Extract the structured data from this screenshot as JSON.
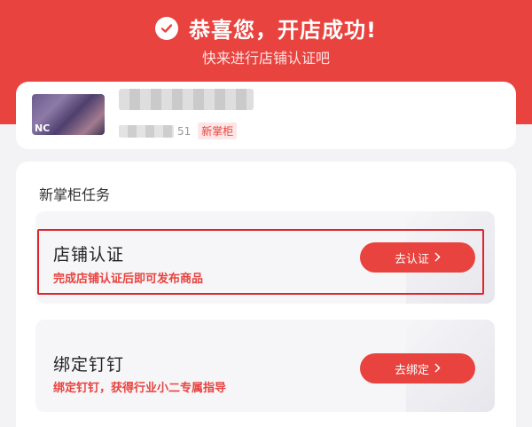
{
  "header": {
    "title": "恭喜您，开店成功!",
    "subtitle": "快来进行店铺认证吧"
  },
  "profile": {
    "avatar_text": "NC",
    "id_tail": "51",
    "role_badge": "新掌柜"
  },
  "tasks": {
    "title": "新掌柜任务",
    "items": [
      {
        "name": "店铺认证",
        "desc": "完成店铺认证后即可发布商品",
        "button": "去认证",
        "highlighted": true
      },
      {
        "name": "绑定钉钉",
        "desc": "绑定钉钉，获得行业小二专属指导",
        "button": "去绑定",
        "highlighted": false
      }
    ]
  },
  "colors": {
    "brand_red": "#e8433f",
    "highlight_border": "#e0252a"
  },
  "icons": {
    "check": "check-circle-icon",
    "chevron": "chevron-right-icon"
  }
}
